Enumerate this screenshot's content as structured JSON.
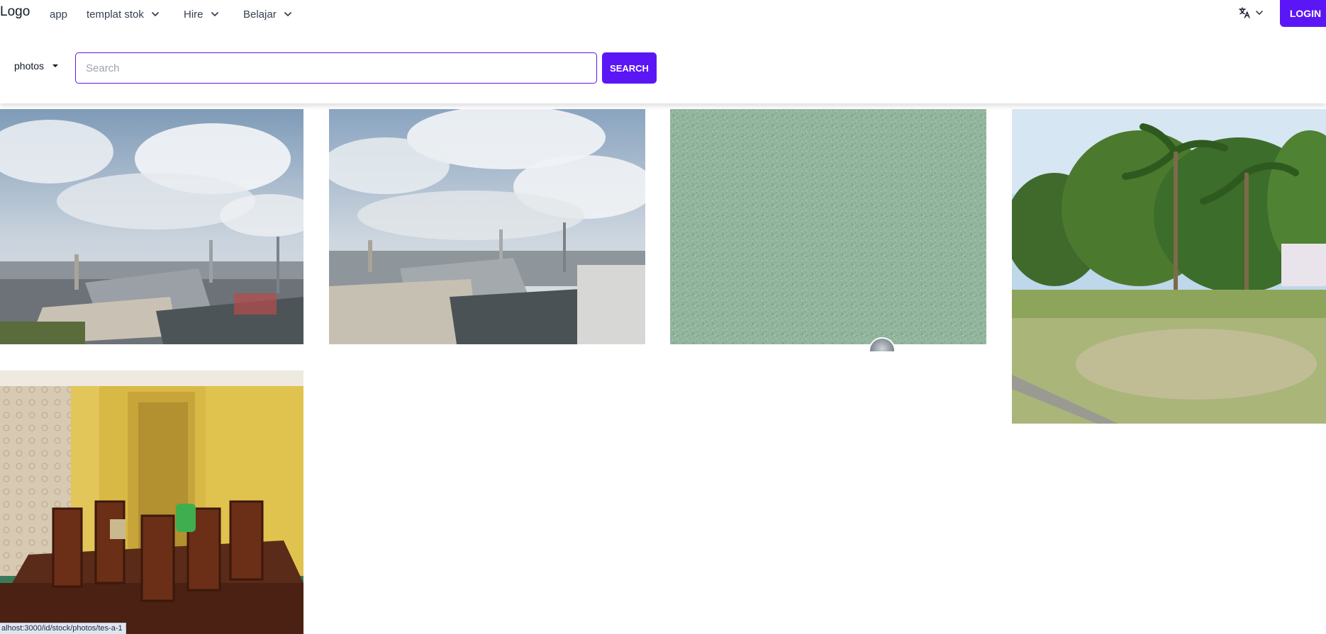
{
  "colors": {
    "accent": "#5b16f5",
    "input_border": "#5b16f5"
  },
  "navbar": {
    "logo": "Logo",
    "items": [
      {
        "label": "app",
        "has_dropdown": false
      },
      {
        "label": "templat stok",
        "has_dropdown": true
      },
      {
        "label": "Hire",
        "has_dropdown": true
      },
      {
        "label": "Belajar",
        "has_dropdown": true
      }
    ],
    "language_icon": "translate-icon",
    "login_label": "LOGIN"
  },
  "search": {
    "category": "photos",
    "placeholder": "Search",
    "value": "",
    "button_label": "SEARCH"
  },
  "photos": [
    {
      "subject": "cloudy-sky-rooftops"
    },
    {
      "subject": "cloudy-sky-rooftops"
    },
    {
      "subject": "green-textured-surface"
    },
    {
      "subject": "palm-trees-field"
    },
    {
      "subject": "yellow-room-dining-chairs"
    }
  ],
  "status_bar": {
    "url": "alhost:3000/id/stock/photos/tes-a-1"
  }
}
